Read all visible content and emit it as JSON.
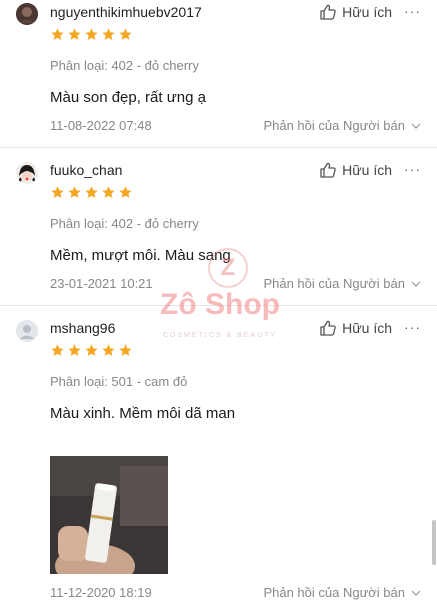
{
  "reviews": [
    {
      "username": "nguyenthikimhuebv2017",
      "rating": 5,
      "variant": "Phân loại: 402 - đỏ cherry",
      "comment": "Màu son đẹp, rất ưng ạ",
      "date": "11-08-2022 07:48",
      "helpful_label": "Hữu ích",
      "reply_label": "Phản hồi của Người bán"
    },
    {
      "username": "fuuko_chan",
      "rating": 5,
      "variant": "Phân loại: 402 - đỏ cherry",
      "comment": "Mềm, mượt môi. Màu sang",
      "date": "23-01-2021 10:21",
      "helpful_label": "Hữu ích",
      "reply_label": "Phản hồi của Người bán"
    },
    {
      "username": "mshang96",
      "rating": 5,
      "variant": "Phân loại: 501 - cam đỏ",
      "comment": "Màu xinh. Mềm môi dã man",
      "date": "11-12-2020 18:19",
      "helpful_label": "Hữu ích",
      "reply_label": "Phản hồi của Người bán"
    }
  ],
  "more_glyph": "···",
  "watermark": {
    "logo_letter": "Z",
    "name": "Zô Shop",
    "tagline": "COSMETICS & BEAUTY"
  },
  "colors": {
    "star": "#f5a623",
    "muted_text": "#888888",
    "divider": "#e6e6e6"
  }
}
